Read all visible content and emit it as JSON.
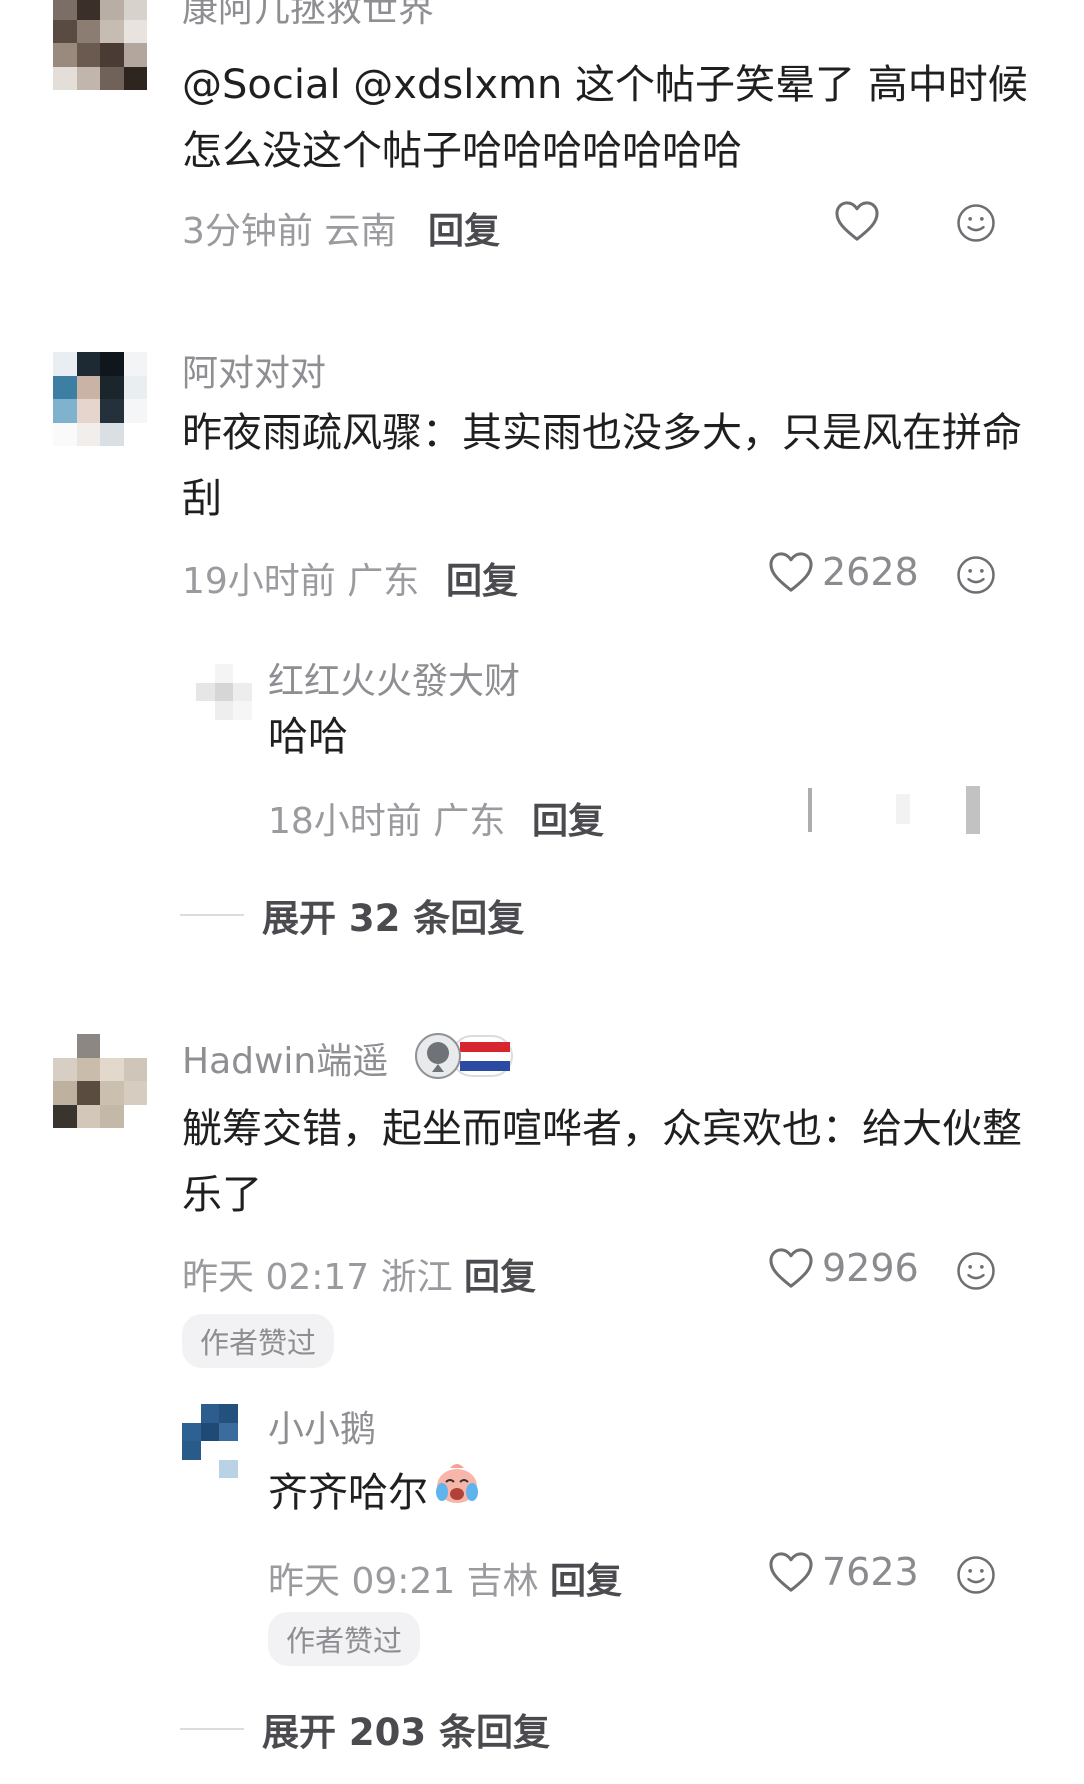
{
  "comments": [
    {
      "name": "康阿几拯救世界",
      "text": "@Social @xdslxmn 这个帖子笑晕了 高中时候怎么没这个帖子哈哈哈哈哈哈哈",
      "time": "3分钟前",
      "region": "云南",
      "reply_label": "回复",
      "likes": ""
    },
    {
      "name": "阿对对对",
      "text": "昨夜雨疏风骤：其实雨也没多大，只是风在拼命刮",
      "time": "19小时前",
      "region": "广东",
      "reply_label": "回复",
      "likes": "2628",
      "replies": [
        {
          "name": "红红火火發大财",
          "text": "哈哈",
          "time": "18小时前",
          "region": "广东",
          "reply_label": "回复"
        }
      ],
      "expand_label": "展开 32 条回复"
    },
    {
      "name": "Hadwin端遥",
      "text": "觥筹交错，起坐而喧哗者，众宾欢也：给大伙整乐了",
      "time": "昨天 02:17",
      "region": "浙江",
      "reply_label": "回复",
      "likes": "9296",
      "badge": "作者赞过",
      "replies": [
        {
          "name": "小小鹅",
          "text": "齐齐哈尔",
          "time": "昨天 09:21",
          "region": "吉林",
          "reply_label": "回复",
          "likes": "7623",
          "badge": "作者赞过"
        }
      ],
      "expand_label": "展开 203 条回复"
    }
  ],
  "icons": {
    "like": "heart-outline-icon",
    "emoji": "smiley-face-icon",
    "sticker": "crying-face-sticker-icon",
    "badge": "soccer-ball-netherlands-flag-icon"
  },
  "colors": {
    "name": "#8e8e93",
    "meta": "#9a9a9f",
    "badge_bg": "#f2f2f4"
  }
}
